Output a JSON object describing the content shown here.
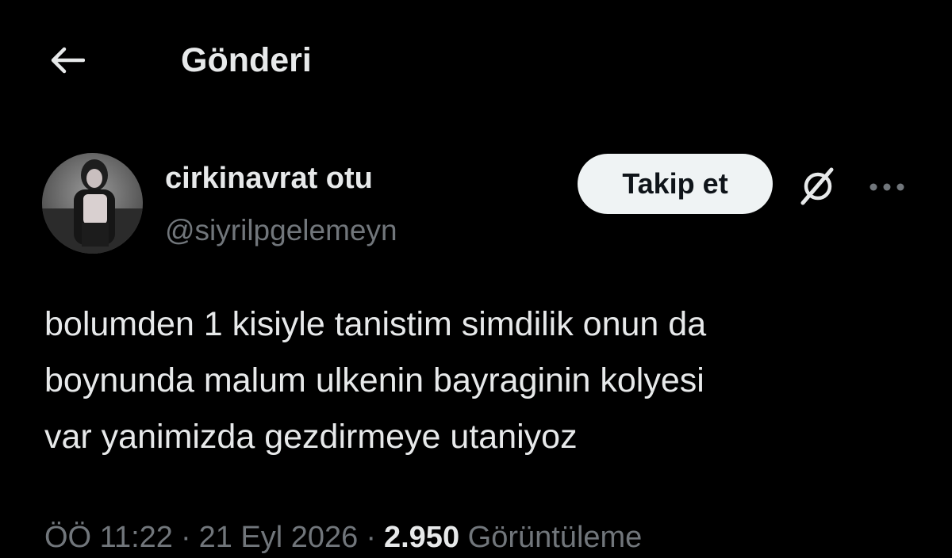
{
  "header": {
    "back_icon": "arrow-left-icon",
    "title": "Gönderi"
  },
  "author": {
    "display_name": "cirkinavrat otu",
    "handle": "@siyrilpgelemeyn",
    "avatar_icon": "profile-photo"
  },
  "actions": {
    "follow_label": "Takip et",
    "grok_icon": "grok-icon",
    "more_icon": "more-dots-icon"
  },
  "tweet": {
    "text": "bolumden 1 kisiyle tanistim simdilik onun da\nboynunda malum ulkenin bayraginin kolyesi\nvar yanimizda gezdirmeye utaniyoz"
  },
  "meta": {
    "time": "ÖÖ 11:22",
    "separator": "·",
    "date": "21 Eyl 2026",
    "views_count": "2.950",
    "views_label": "Görüntüleme"
  },
  "colors": {
    "background": "#000000",
    "primary_text": "#e7e9ea",
    "secondary_text": "#71767b",
    "follow_button_bg": "#eff3f4",
    "follow_button_text": "#0f1419"
  }
}
